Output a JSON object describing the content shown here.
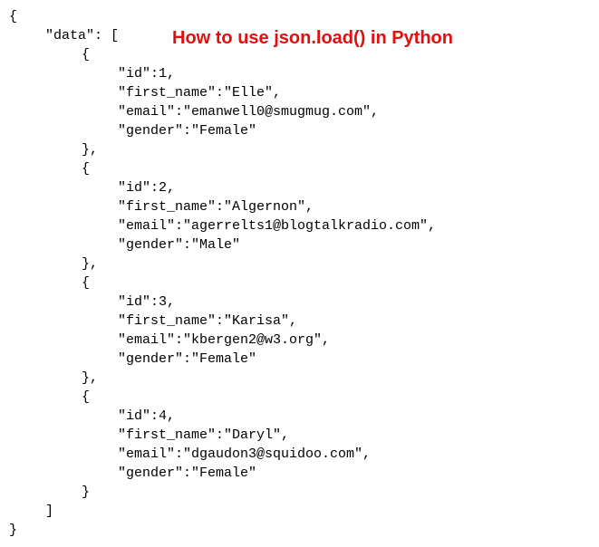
{
  "annotation": "How to use json.load() in Python",
  "code": {
    "open_brace": "{",
    "data_open": "\"data\": [",
    "obj_open": "{",
    "obj_close": "},",
    "obj_close_last": "}",
    "arr_close": "]",
    "close_brace": "}",
    "records": [
      {
        "id_line": "\"id\":1,",
        "first_name_line": "\"first_name\":\"Elle\",",
        "email_line": "\"email\":\"emanwell0@smugmug.com\",",
        "gender_line": "\"gender\":\"Female\""
      },
      {
        "id_line": "\"id\":2,",
        "first_name_line": "\"first_name\":\"Algernon\",",
        "email_line": "\"email\":\"agerrelts1@blogtalkradio.com\",",
        "gender_line": "\"gender\":\"Male\""
      },
      {
        "id_line": "\"id\":3,",
        "first_name_line": "\"first_name\":\"Karisa\",",
        "email_line": "\"email\":\"kbergen2@w3.org\",",
        "gender_line": "\"gender\":\"Female\""
      },
      {
        "id_line": "\"id\":4,",
        "first_name_line": "\"first_name\":\"Daryl\",",
        "email_line": "\"email\":\"dgaudon3@squidoo.com\",",
        "gender_line": "\"gender\":\"Female\""
      }
    ]
  }
}
